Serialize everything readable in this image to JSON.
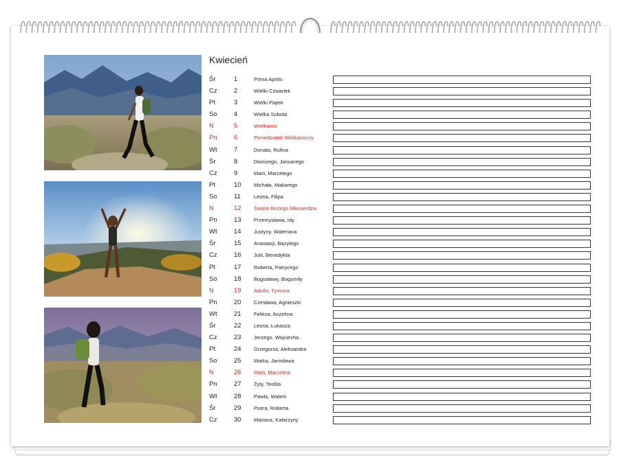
{
  "calendar": {
    "month": "Kwiecień",
    "days": [
      {
        "dow": "Śr",
        "day": "1",
        "name": "Prima Aprilis",
        "holiday": false
      },
      {
        "dow": "Cz",
        "day": "2",
        "name": "Wielki Czwartek",
        "holiday": false
      },
      {
        "dow": "Pt",
        "day": "3",
        "name": "Wielki Piątek",
        "holiday": false
      },
      {
        "dow": "So",
        "day": "4",
        "name": "Wielka Sobota",
        "holiday": false
      },
      {
        "dow": "N",
        "day": "5",
        "name": "Wielkanoc",
        "holiday": true
      },
      {
        "dow": "Pn",
        "day": "6",
        "name": "Poniedziałek Wielkanocny",
        "holiday": true
      },
      {
        "dow": "Wt",
        "day": "7",
        "name": "Donata, Rufina",
        "holiday": false
      },
      {
        "dow": "Śr",
        "day": "8",
        "name": "Dionizego, Januarego",
        "holiday": false
      },
      {
        "dow": "Cz",
        "day": "9",
        "name": "Marii, Marcelego",
        "holiday": false
      },
      {
        "dow": "Pt",
        "day": "10",
        "name": "Michała, Makarego",
        "holiday": false
      },
      {
        "dow": "So",
        "day": "11",
        "name": "Leona, Filipa",
        "holiday": false
      },
      {
        "dow": "N",
        "day": "12",
        "name": "Święto Bożego Miłosierdzia",
        "holiday": true
      },
      {
        "dow": "Pn",
        "day": "13",
        "name": "Przemysława, Idy",
        "holiday": false
      },
      {
        "dow": "Wt",
        "day": "14",
        "name": "Justyny, Waleriana",
        "holiday": false
      },
      {
        "dow": "Śr",
        "day": "15",
        "name": "Anastazji, Bazylego",
        "holiday": false
      },
      {
        "dow": "Cz",
        "day": "16",
        "name": "Julii, Benedykta",
        "holiday": false
      },
      {
        "dow": "Pt",
        "day": "17",
        "name": "Roberta, Patrycego",
        "holiday": false
      },
      {
        "dow": "So",
        "day": "18",
        "name": "Bogusławy, Bogumiły",
        "holiday": false
      },
      {
        "dow": "N",
        "day": "19",
        "name": "Adolfa, Tymona",
        "holiday": true
      },
      {
        "dow": "Pn",
        "day": "20",
        "name": "Czesława, Agnieszki",
        "holiday": false
      },
      {
        "dow": "Wt",
        "day": "21",
        "name": "Feliksa, Anzelma",
        "holiday": false
      },
      {
        "dow": "Śr",
        "day": "22",
        "name": "Leona, Łukasza",
        "holiday": false
      },
      {
        "dow": "Cz",
        "day": "23",
        "name": "Jerzego, Wojciecha",
        "holiday": false
      },
      {
        "dow": "Pt",
        "day": "24",
        "name": "Grzegorza, Aleksandra",
        "holiday": false
      },
      {
        "dow": "So",
        "day": "25",
        "name": "Marka, Jarosława",
        "holiday": false
      },
      {
        "dow": "N",
        "day": "26",
        "name": "Marii, Marcelina",
        "holiday": true
      },
      {
        "dow": "Pn",
        "day": "27",
        "name": "Żyty, Teofila",
        "holiday": false
      },
      {
        "dow": "Wt",
        "day": "28",
        "name": "Pawła, Walerii",
        "holiday": false
      },
      {
        "dow": "Śr",
        "day": "29",
        "name": "Piotra, Roberta",
        "holiday": false
      },
      {
        "dow": "Cz",
        "day": "30",
        "name": "Mariana, Katarzyny",
        "holiday": false
      }
    ],
    "colors": {
      "holiday": "#e3261c",
      "text": "#222222"
    }
  },
  "photos": [
    {
      "icon": "hiker-walking-mountains-photo"
    },
    {
      "icon": "hiker-arms-raised-sunset-photo"
    },
    {
      "icon": "hiker-backpack-meadow-photo"
    }
  ]
}
